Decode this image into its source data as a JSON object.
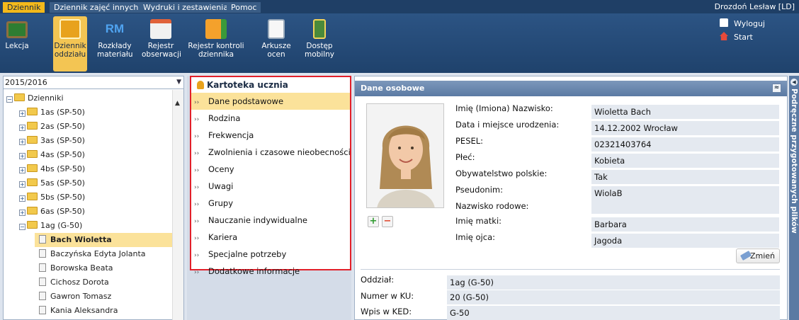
{
  "menubar": {
    "tabs": [
      "Dziennik",
      "Dziennik zajęć innych",
      "Wydruki i zestawienia",
      "Pomoc"
    ],
    "user": "Drozdoń Lesław [LD]"
  },
  "ribbon": {
    "buttons": [
      {
        "line1": "Lekcja",
        "line2": ""
      },
      {
        "line1": "Dziennik",
        "line2": "oddziału"
      },
      {
        "line1": "Rozkłady",
        "line2": "materiału"
      },
      {
        "line1": "Rejestr",
        "line2": "obserwacji"
      },
      {
        "line1": "Rejestr kontroli",
        "line2": "dziennika"
      },
      {
        "line1": "Arkusze",
        "line2": "ocen"
      },
      {
        "line1": "Dostęp",
        "line2": "mobilny"
      }
    ],
    "rm_label": "RM",
    "logout": "Wyloguj",
    "start": "Start"
  },
  "tree": {
    "year": "2015/2016",
    "root": "Dzienniki",
    "classes": [
      "1as (SP-50)",
      "2as (SP-50)",
      "3as (SP-50)",
      "4as (SP-50)",
      "4bs (SP-50)",
      "5as (SP-50)",
      "5bs (SP-50)",
      "6as (SP-50)",
      "1ag (G-50)"
    ],
    "students": [
      "Bach Wioletta",
      "Baczyńska Edyta Jolanta",
      "Borowska Beata",
      "Cichosz Dorota",
      "Gawron Tomasz",
      "Kania Aleksandra"
    ]
  },
  "menu": {
    "title": "Kartoteka ucznia",
    "items": [
      "Dane podstawowe",
      "Rodzina",
      "Frekwencja",
      "Zwolnienia i czasowe nieobecności",
      "Oceny",
      "Uwagi",
      "Grupy",
      "Nauczanie indywidualne",
      "Kariera",
      "Specjalne potrzeby",
      "Dodatkowe informacje"
    ]
  },
  "details": {
    "header": "Dane osobowe",
    "fields": [
      {
        "label": "Imię (Imiona) Nazwisko:",
        "value": "Wioletta Bach"
      },
      {
        "label": "Data i miejsce urodzenia:",
        "value": "14.12.2002 Wrocław"
      },
      {
        "label": "PESEL:",
        "value": "02321403764"
      },
      {
        "label": "Płeć:",
        "value": "Kobieta"
      },
      {
        "label": "Obywatelstwo polskie:",
        "value": "Tak"
      },
      {
        "label": "Pseudonim:",
        "value": "WiolaB"
      },
      {
        "label": "Nazwisko rodowe:",
        "value": ""
      },
      {
        "label": "Imię matki:",
        "value": "Barbara"
      },
      {
        "label": "Imię ojca:",
        "value": "Jagoda"
      }
    ],
    "edit_button": "Zmień",
    "bottom_fields": [
      {
        "label": "Oddział:",
        "value": "1ag (G-50)"
      },
      {
        "label": "Numer w KU:",
        "value": "20 (G-50)"
      },
      {
        "label": "Wpis w KED:",
        "value": "G-50"
      }
    ]
  },
  "side_tab": "Podręczne przygotowanych plików",
  "colors": {
    "accent": "#f3b91b",
    "nav": "#1f3f66",
    "highlight": "#fbe29a",
    "frame": "#e2202a"
  }
}
